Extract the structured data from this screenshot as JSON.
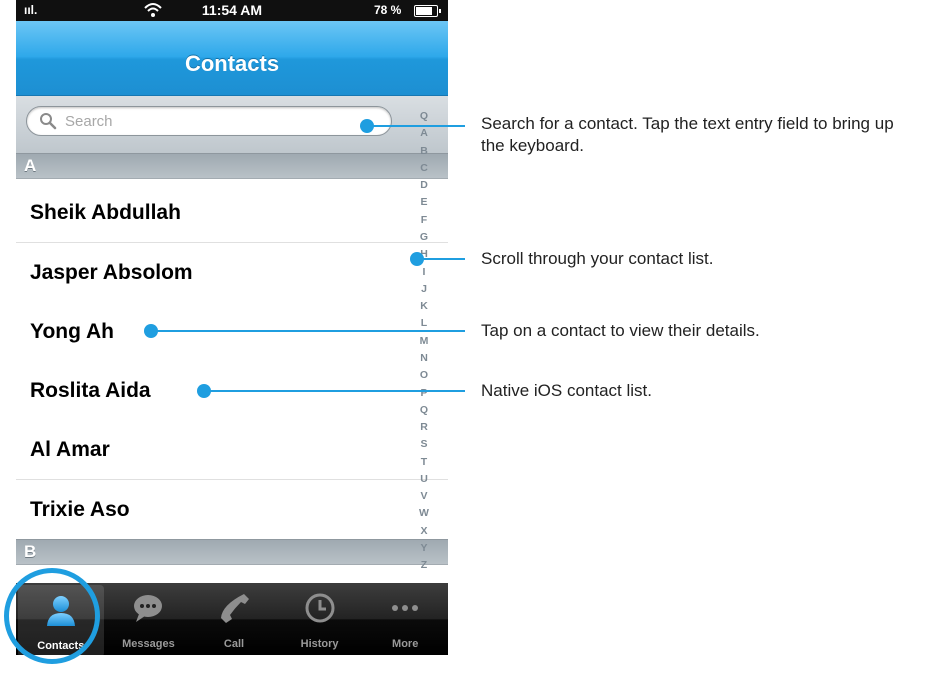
{
  "status_bar": {
    "signal": "ııl.",
    "time": "11:54 AM",
    "battery_text": "78 %",
    "battery_level": 0.78
  },
  "nav": {
    "title": "Contacts"
  },
  "search": {
    "placeholder": "Search"
  },
  "sections": [
    {
      "letter": "A",
      "contacts": [
        "Sheik Abdullah",
        "Jasper Absolom",
        "Yong Ah",
        "Roslita Aida",
        "Al Amar",
        "Trixie Aso"
      ]
    },
    {
      "letter": "B",
      "contacts": []
    }
  ],
  "index_letters": [
    "Q",
    "A",
    "B",
    "C",
    "D",
    "E",
    "F",
    "G",
    "H",
    "I",
    "J",
    "K",
    "L",
    "M",
    "N",
    "O",
    "P",
    "Q",
    "R",
    "S",
    "T",
    "U",
    "V",
    "W",
    "X",
    "Y",
    "Z"
  ],
  "tabs": [
    {
      "label": "Contacts",
      "icon": "person-icon",
      "selected": true
    },
    {
      "label": "Messages",
      "icon": "speech-bubble-icon",
      "selected": false
    },
    {
      "label": "Call",
      "icon": "phone-handset-icon",
      "selected": false
    },
    {
      "label": "History",
      "icon": "clock-icon",
      "selected": false
    },
    {
      "label": "More",
      "icon": "more-dots-icon",
      "selected": false
    }
  ],
  "annotations": [
    {
      "text": "Search for a contact. Tap the text entry field to bring up the keyboard."
    },
    {
      "text": "Scroll through your contact list."
    },
    {
      "text": "Tap on a contact to view their details."
    },
    {
      "text": "Native iOS contact list."
    }
  ],
  "colors": {
    "accent": "#1f9ee0",
    "nav_blue": "#2ea8ea",
    "tabbar": "#000000"
  }
}
